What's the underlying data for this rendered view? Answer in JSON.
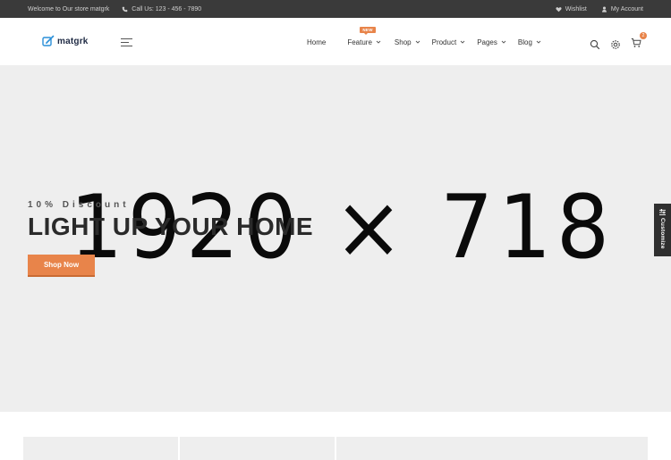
{
  "topbar": {
    "welcome": "Welcome to Our store matgrk",
    "phone": "Call Us: 123 - 456 - 7890",
    "wishlist": "Wishlist",
    "account": "My Account"
  },
  "header": {
    "logo_text": "matgrk",
    "nav": [
      {
        "label": "Home",
        "has_dropdown": false
      },
      {
        "label": "Feature",
        "has_dropdown": true,
        "badge": "NEW"
      },
      {
        "label": "Shop",
        "has_dropdown": true
      },
      {
        "label": "Product",
        "has_dropdown": true
      },
      {
        "label": "Pages",
        "has_dropdown": true
      },
      {
        "label": "Blog",
        "has_dropdown": true
      }
    ],
    "cart_count": "2",
    "icons": [
      "search-icon",
      "settings-icon",
      "cart-icon"
    ]
  },
  "hero": {
    "placeholder": "1920 × 718",
    "discount": "10% Discount",
    "title": "LIGHT UP YOUR HOME",
    "button": "Shop Now"
  },
  "customize": {
    "label": "Customize"
  },
  "colors": {
    "accent": "#e8844a",
    "topbar_bg": "#3a3a3a",
    "hero_bg": "#eeeeee"
  }
}
